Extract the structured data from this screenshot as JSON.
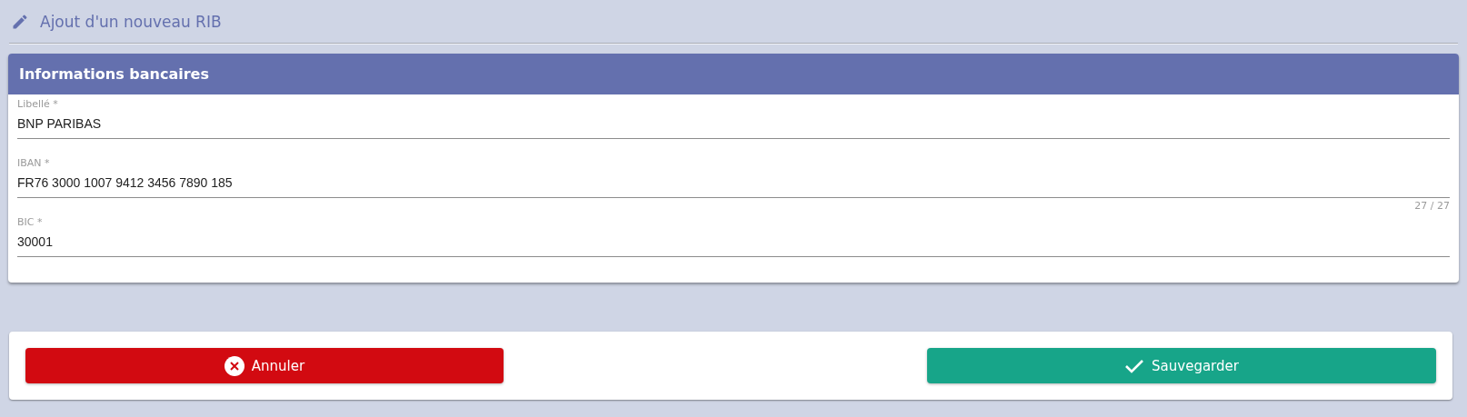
{
  "page": {
    "title": "Ajout d'un nouveau RIB"
  },
  "card": {
    "title": "Informations bancaires"
  },
  "fields": [
    {
      "label": "Libellé *",
      "value": "BNP PARIBAS"
    },
    {
      "label": "IBAN *",
      "value": "FR76 3000 1007 9412 3456 7890 185",
      "counter": "27 / 27"
    },
    {
      "label": "BIC *",
      "value": "30001"
    }
  ],
  "buttons": [
    {
      "kind": "cancel",
      "label": "Annuler"
    },
    {
      "kind": "save",
      "label": "Sauvegarder"
    }
  ]
}
